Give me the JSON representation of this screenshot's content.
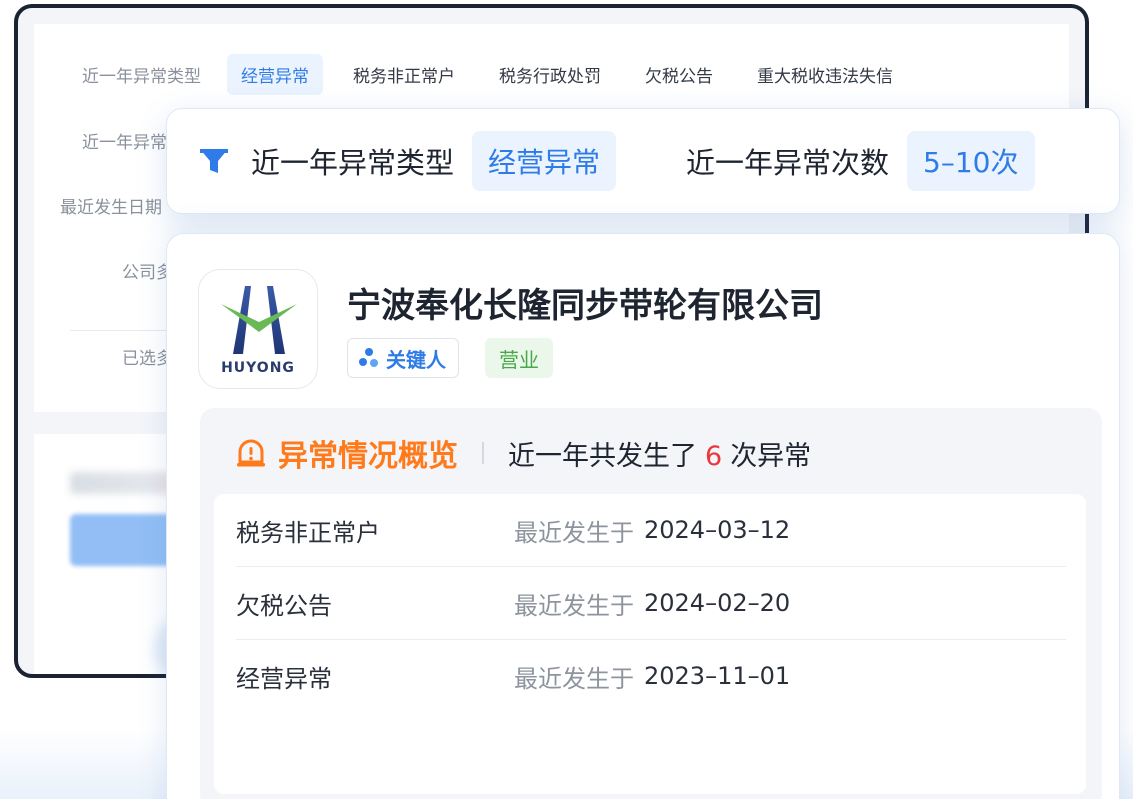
{
  "back_window": {
    "tabs": [
      {
        "label": "近一年异常类型",
        "kind": "label"
      },
      {
        "label": "经营异常",
        "kind": "active"
      },
      {
        "label": "税务非正常户",
        "kind": "tab"
      },
      {
        "label": "税务行政处罚",
        "kind": "tab"
      },
      {
        "label": "欠税公告",
        "kind": "tab"
      },
      {
        "label": "重大税收违法失信",
        "kind": "tab"
      }
    ],
    "rows": {
      "count_label": "近一年异常次",
      "date_label": "最近发生日期",
      "company_label": "公司多",
      "selected_label": "已选多"
    }
  },
  "filter_bar": {
    "type_label": "近一年异常类型",
    "type_value": "经营异常",
    "count_label": "近一年异常次数",
    "count_value": "5–10次"
  },
  "company": {
    "logo_text": "HUYONG",
    "name": "宁波奉化长隆同步带轮有限公司",
    "key_person_label": "关键人",
    "status_label": "营业"
  },
  "anomaly": {
    "title": "异常情况概览",
    "summary_prefix": "近一年共发生了",
    "summary_count": "6",
    "summary_suffix": "次异常",
    "items": [
      {
        "name": "税务非正常户",
        "prefix": "最近发生于",
        "date": "2024–03–12"
      },
      {
        "name": "欠税公告",
        "prefix": "最近发生于",
        "date": "2024–02–20"
      },
      {
        "name": "经营异常",
        "prefix": "最近发生于",
        "date": "2023–11–01"
      }
    ]
  },
  "colors": {
    "accent_blue": "#2f7be8",
    "chip_bg": "#eaf3fe",
    "alert_orange": "#ff7a1a",
    "count_red": "#e8383d",
    "status_green": "#48a94a"
  }
}
